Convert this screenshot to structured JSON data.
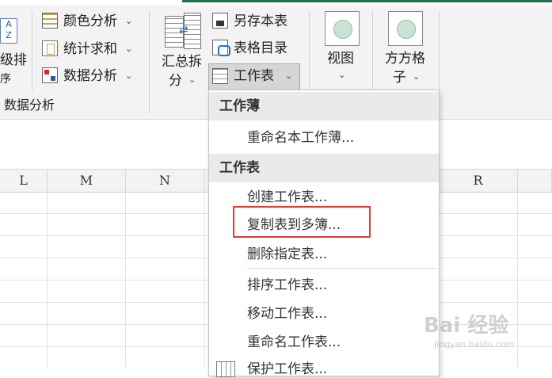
{
  "ribbon": {
    "sort_label_top": "级排",
    "sort_label_bottom": "序",
    "color_analysis": "颜色分析",
    "stat_sum": "统计求和",
    "data_analysis": "数据分析",
    "group_label": "数据分析",
    "merge_split_line1": "汇总拆",
    "merge_split_line2": "分",
    "save_copy": "另存本表",
    "sheet_catalog": "表格目录",
    "worksheet": "工作表",
    "view": "视图",
    "fangfang_line1": "方方格",
    "fangfang_line2": "子"
  },
  "columns": [
    "L",
    "M",
    "N",
    "R"
  ],
  "menu": {
    "section_workbook": "工作薄",
    "rename_workbook": "重命名本工作薄...",
    "section_worksheet": "工作表",
    "create_sheet": "创建工作表...",
    "copy_to_books": "复制表到多簿...",
    "delete_sheet": "删除指定表...",
    "sort_sheet": "排序工作表...",
    "move_sheet": "移动工作表...",
    "rename_sheet": "重命名工作表...",
    "protect_sheet": "保护工作表..."
  },
  "watermark": {
    "brand": "Bai 经验",
    "url": "jingyan.baidu.com"
  }
}
